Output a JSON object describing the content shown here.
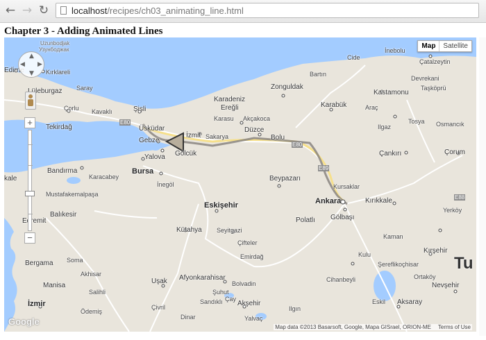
{
  "browser": {
    "back_icon": "back-arrow-icon",
    "forward_icon": "forward-arrow-icon",
    "reload_icon": "reload-icon",
    "url_host": "localhost",
    "url_path": "/recipes/ch03_animating_line.html"
  },
  "page": {
    "title": "Chapter 3 - Adding Animated Lines"
  },
  "map": {
    "map_type": {
      "map": "Map",
      "satellite": "Satellite"
    },
    "zoom_in": "+",
    "zoom_out": "−",
    "logo": "Google",
    "copyright": "Map data ©2013 Basarsoft, Google, Mapa GISrael, ORION-ME",
    "terms": "Terms of Use",
    "route_color": "#8a8580",
    "water_color": "#a3ccff",
    "land_color": "#e9e5dc",
    "labels": {
      "uzunbodjak": "Uzunbodjak",
      "uzunbodjak2": "Узунбоджак",
      "edirne": "Edirne",
      "kirklareli": "Kırklareli",
      "luleburgaz": "Lüleburgaz",
      "saray": "Saray",
      "corlu": "Çorlu",
      "kavakli": "Kavaklı",
      "sisli": "Şişli",
      "uskudar": "Üsküdar",
      "tekirdag": "Tekirdağ",
      "gebze": "Gebze",
      "izmit": "İzmit",
      "sakarya": "Sakarya",
      "golcuk": "Gölcük",
      "yalova": "Yalova",
      "bursa": "Bursa",
      "karacabey": "Karacabey",
      "bandirma": "Bandırma",
      "inegol": "İnegöl",
      "mustafakemalpasa": "Mustafakemalpaşa",
      "balikesir": "Balıkesir",
      "edremit": "Edremit",
      "eskisehir": "Eskişehir",
      "kutahya": "Kütahya",
      "seyitgazi": "Seyitgazi",
      "bergama": "Bergama",
      "soma": "Soma",
      "akhisar": "Akhisar",
      "manisa": "Manisa",
      "salihli": "Salihli",
      "odemis": "Ödemiş",
      "izmir": "İzmir",
      "usak": "Uşak",
      "afyonkarahisar": "Afyonkarahisar",
      "cifteler": "Çifteler",
      "emirdag": "Emirdağ",
      "bolvadin": "Bolvadin",
      "suhut": "Şuhut",
      "cay": "Çay",
      "aksehir": "Akşehir",
      "civril": "Çivril",
      "sandikli": "Sandıklı",
      "dinar": "Dinar",
      "yalvac": "Yalvaç",
      "ilgin": "Ilgın",
      "polatli": "Polatlı",
      "golbasi": "Gölbaşı",
      "ankara": "Ankara",
      "kursaklar": "Kursaklar",
      "beypazari": "Beypazarı",
      "bolu": "Bolu",
      "duzce": "Düzce",
      "akcakoca": "Akçakoca",
      "karadeniz_eregli_1": "Karadeniz",
      "karadeniz_eregli_2": "Ereğli",
      "karasu": "Karasu",
      "zonguldak": "Zonguldak",
      "bartin": "Bartın",
      "karabuk": "Karabük",
      "kastamonu": "Kastamonu",
      "tasköpru": "Taşköprü",
      "cide": "Cide",
      "inebolu": "İnebolu",
      "catalzeytin": "Çatalzeytin",
      "devrekani": "Devrekani",
      "arac": "Araç",
      "tosya": "Tosya",
      "ilgaz": "Ilgaz",
      "osmancik": "Osmancık",
      "cankiri": "Çankırı",
      "corum": "Çorum",
      "kirikkale": "Kırıkkale",
      "yerkoy": "Yerköy",
      "kaman": "Kaman",
      "kirsehir": "Kırşehir",
      "kulu": "Kulu",
      "serefli": "Şereflikoçhisar",
      "ortakoy": "Ortaköy",
      "nevsehir": "Nevşehir",
      "esil": "Eskil",
      "aksaray": "Aksaray",
      "cihanbeyli": "Cihanbeyli",
      "turkey": "Tu",
      "road_e80a": "E80",
      "road_e80b": "E80",
      "road_e89": "E89",
      "road_e881": "E88",
      "kale": "kale"
    }
  }
}
